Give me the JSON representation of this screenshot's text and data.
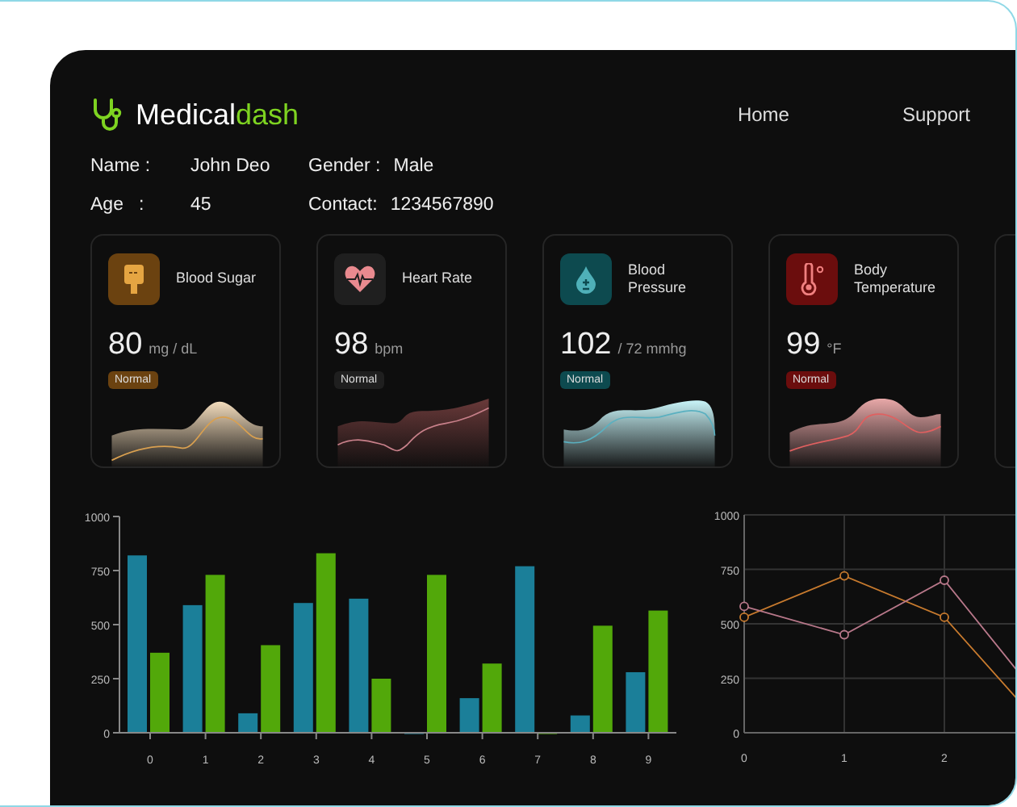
{
  "brand": {
    "name": "Medical",
    "accent": "dash"
  },
  "nav": [
    {
      "label": "Home"
    },
    {
      "label": "Support"
    }
  ],
  "patient": [
    {
      "label": "Name :",
      "value": "John Deo"
    },
    {
      "label": "Gender :",
      "value": "Male"
    },
    {
      "label": "Age   :",
      "value": "45"
    },
    {
      "label": "Contact:",
      "value": "1234567890"
    }
  ],
  "vitals": [
    {
      "kind": "sugar",
      "title": "Blood Sugar",
      "value": "80",
      "unit": "mg / dL",
      "status": "Normal",
      "color": "#6b4210"
    },
    {
      "kind": "heart",
      "title": "Heart Rate",
      "value": "98",
      "unit": "bpm",
      "status": "Normal",
      "color": "#1f1f1f"
    },
    {
      "kind": "pressure",
      "title": "Blood Pressure",
      "value": "102",
      "unit": "/ 72 mmhg",
      "status": "Normal",
      "color": "#0d4a4f"
    },
    {
      "kind": "temperature",
      "title": "Body Temperature",
      "value": "99",
      "unit": "°F",
      "status": "Normal",
      "color": "#6b0d0d"
    }
  ],
  "bar_chart": {
    "chart_data": {
      "type": "bar",
      "categories": [
        "0",
        "1",
        "2",
        "3",
        "4",
        "5",
        "6",
        "7",
        "8",
        "9"
      ],
      "series": [
        {
          "color": "#1b7f99",
          "values": [
            820,
            590,
            90,
            600,
            620,
            0,
            160,
            770,
            80,
            280
          ]
        },
        {
          "color": "#52a80a",
          "values": [
            370,
            730,
            405,
            830,
            250,
            730,
            320,
            0,
            495,
            565
          ]
        }
      ],
      "ylim": [
        0,
        1000
      ],
      "yticks": [
        0,
        250,
        500,
        750,
        1000
      ]
    }
  },
  "line_chart": {
    "chart_data": {
      "type": "line",
      "x": [
        0,
        1,
        2,
        3
      ],
      "xticks": [
        0,
        1,
        2
      ],
      "xlim": [
        0,
        3
      ],
      "grid": true,
      "series": [
        {
          "color": "#c77a2e",
          "values": [
            530,
            720,
            530,
            15
          ]
        },
        {
          "color": "#b8788a",
          "values": [
            580,
            450,
            700,
            130
          ]
        }
      ],
      "ylim": [
        0,
        1000
      ],
      "yticks": [
        0,
        250,
        500,
        750,
        1000
      ]
    }
  }
}
